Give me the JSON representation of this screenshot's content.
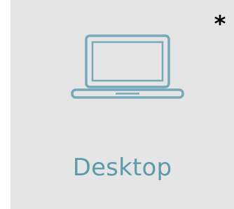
{
  "tile": {
    "label": "Desktop",
    "icon": "laptop-icon",
    "marker": "*"
  },
  "colors": {
    "tile_background": "#e5e5e5",
    "accent": "#5e9aa9",
    "icon_stroke": "#75a8b8",
    "marker": "#000000"
  }
}
